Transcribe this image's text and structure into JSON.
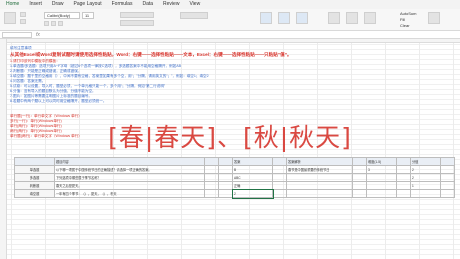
{
  "ribbon": {
    "tabs": [
      "Home",
      "Insert",
      "Draw",
      "Page Layout",
      "Formulas",
      "Data",
      "Review",
      "View"
    ],
    "font_name": "Calibri(Body)",
    "font_size": "11",
    "autosum_label": "AutoSum",
    "fill_label": "Fill",
    "clear_label": "Clear"
  },
  "sheet": {
    "note_title": "填写注意事项",
    "line1": "从其他Excel或Word复制试题时请使用选择性粘贴，Word：右键——选择性粘贴——文本，Excel：右键——选择性粘贴——只粘贴“值”。",
    "line2": "1.请打印该列中模板中的模板：",
    "rules": [
      "1.单选题/多选题：选项只用A~F字母（超过6个选项一律按C选项），多选题答案中不能用空格隔开，例如AB",
      "2.判断题：只能是正确或错误，正确或错误。",
      "3.填空题：题干里的空格用（），中间不要有空格，答案里如果有多个空，用“；”分隔，请用英文的“；”，例如：填空1；填空2",
      "4.问答题：答案无需。",
      "5.试卷：可以设置，导入时，题型必须，一个单元格只能一个，多个用“；”分隔，例如“第二行说明”",
      "6.分值：没有导入的题目默认为分值，分值不能为空。",
      "7.图片：如图片等需要注明图片上标准的题目编号。",
      "8.若题中有两个题以上可以同时用空格隔开，题型必须统一。"
    ],
    "levels": [
      "单行题(一行)：单行单文字（Windows 单行）",
      "多行(一行)：单行(Windows单行)",
      "单行(两行)：单行(Windows单行)",
      "两行(两行)：单行(Windows单行)",
      "单行题(两行)：单行单文字（Windows 单行）"
    ],
    "banner": "[春|春天]、[秋|秋天]"
  },
  "table": {
    "headers": [
      "",
      "题目内容",
      "",
      "",
      "答案",
      "",
      "答案解析",
      "",
      "难度(1-5)",
      "",
      "分值",
      ""
    ],
    "rows": [
      {
        "label": "单选题",
        "content": "以下哪一项属于中国传统节日的正确描述？请选择一项正确的答案。",
        "answer": "B",
        "analysis": "春节是中国最重要的传统节日",
        "difficulty": "3",
        "score": "2"
      },
      {
        "label": "多选题",
        "content": "下列选项中哪些属于季节名称？",
        "answer": "ABC",
        "analysis": "",
        "difficulty": "",
        "score": "2"
      },
      {
        "label": "判断题",
        "content": "春天之后是夏天。",
        "answer": "正确",
        "analysis": "",
        "difficulty": "",
        "score": "1"
      },
      {
        "label": "填空题",
        "content": "一年有四个季节：（），夏天，（），冬天",
        "answer": "2",
        "analysis": "",
        "difficulty": "",
        "score": ""
      }
    ]
  }
}
